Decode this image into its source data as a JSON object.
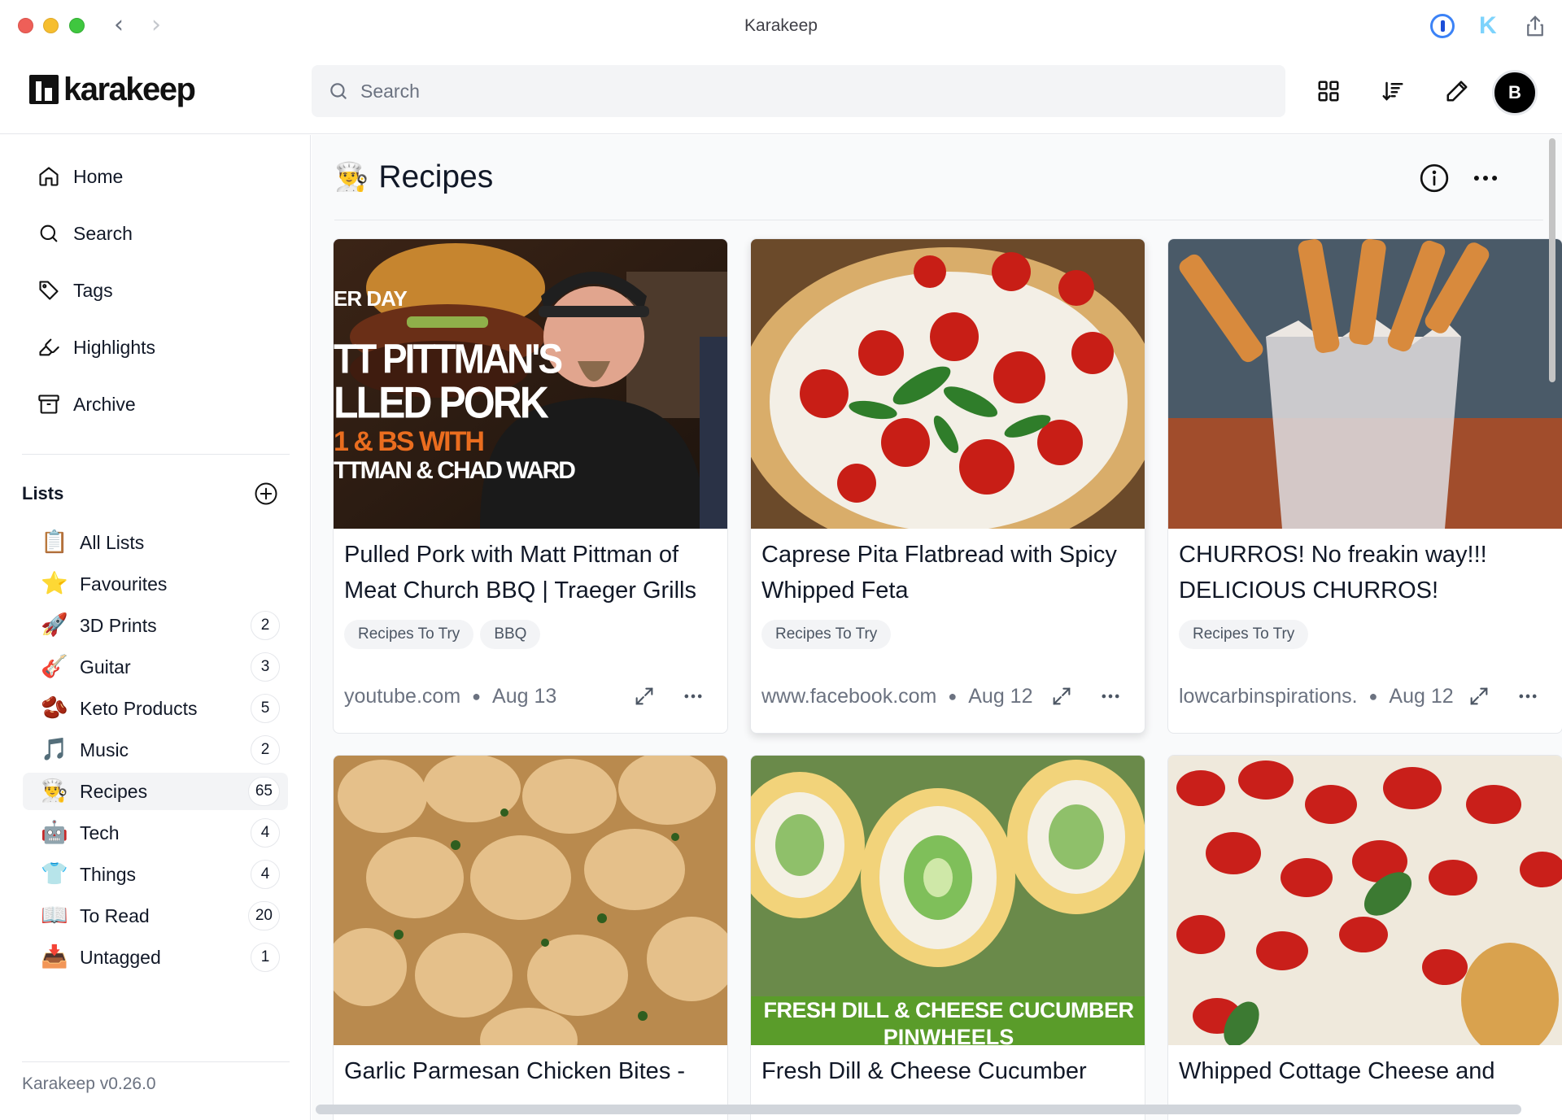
{
  "window": {
    "title": "Karakeep"
  },
  "header": {
    "logo_text": "karakeep",
    "search_placeholder": "Search",
    "user_initial": "B"
  },
  "sidebar": {
    "nav": [
      {
        "label": "Home",
        "icon": "home-icon"
      },
      {
        "label": "Search",
        "icon": "search-icon"
      },
      {
        "label": "Tags",
        "icon": "tag-icon"
      },
      {
        "label": "Highlights",
        "icon": "highlighter-icon"
      },
      {
        "label": "Archive",
        "icon": "archive-icon"
      }
    ],
    "lists_title": "Lists",
    "lists": [
      {
        "emoji": "📋",
        "label": "All Lists",
        "count": ""
      },
      {
        "emoji": "⭐",
        "label": "Favourites",
        "count": ""
      },
      {
        "emoji": "🚀",
        "label": "3D Prints",
        "count": "2"
      },
      {
        "emoji": "🎸",
        "label": "Guitar",
        "count": "3"
      },
      {
        "emoji": "🫘",
        "label": "Keto Products",
        "count": "5"
      },
      {
        "emoji": "🎵",
        "label": "Music",
        "count": "2"
      },
      {
        "emoji": "👨‍🍳",
        "label": "Recipes",
        "count": "65"
      },
      {
        "emoji": "🤖",
        "label": "Tech",
        "count": "4"
      },
      {
        "emoji": "👕",
        "label": "Things",
        "count": "4"
      },
      {
        "emoji": "📖",
        "label": "To Read",
        "count": "20"
      },
      {
        "emoji": "📥",
        "label": "Untagged",
        "count": "1"
      }
    ],
    "version": "Karakeep v0.26.0"
  },
  "main": {
    "title_emoji": "👨‍🍳",
    "title": "Recipes",
    "cards": [
      {
        "title": "Pulled Pork with Matt Pittman of Meat Church BBQ | Traeger Grills",
        "tags": [
          "Recipes To Try",
          "BBQ"
        ],
        "source": "youtube.com",
        "date": "Aug 13",
        "image": "bbq",
        "overlay": [
          "ER DAY",
          "TT PITTMAN'S",
          "LLED PORK",
          "1 & BS WITH",
          "TTMAN & CHAD WARD"
        ]
      },
      {
        "title": "Caprese Pita Flatbread with Spicy Whipped Feta",
        "tags": [
          "Recipes To Try"
        ],
        "source": "www.facebook.com",
        "date": "Aug 12",
        "image": "flatbread"
      },
      {
        "title": "CHURROS! No freakin way!!! DELICIOUS CHURROS!",
        "tags": [
          "Recipes To Try"
        ],
        "source": "lowcarbinspirations.",
        "date": "Aug 12",
        "image": "churros"
      },
      {
        "title": "Garlic Parmesan Chicken Bites -",
        "tags": [],
        "source": "",
        "date": "",
        "image": "chicken"
      },
      {
        "title": "Fresh Dill & Cheese Cucumber",
        "tags": [],
        "source": "",
        "date": "",
        "image": "pinwheels",
        "overlay": [
          "FRESH DILL & CHEESE CUCUMBER",
          "PINWHEELS"
        ]
      },
      {
        "title": "Whipped Cottage Cheese and",
        "tags": [],
        "source": "",
        "date": "",
        "image": "tomatoes"
      }
    ]
  },
  "colors": {
    "accent": "#111111",
    "tag_bg": "#f3f4f6",
    "main_bg": "#f9fafb"
  }
}
